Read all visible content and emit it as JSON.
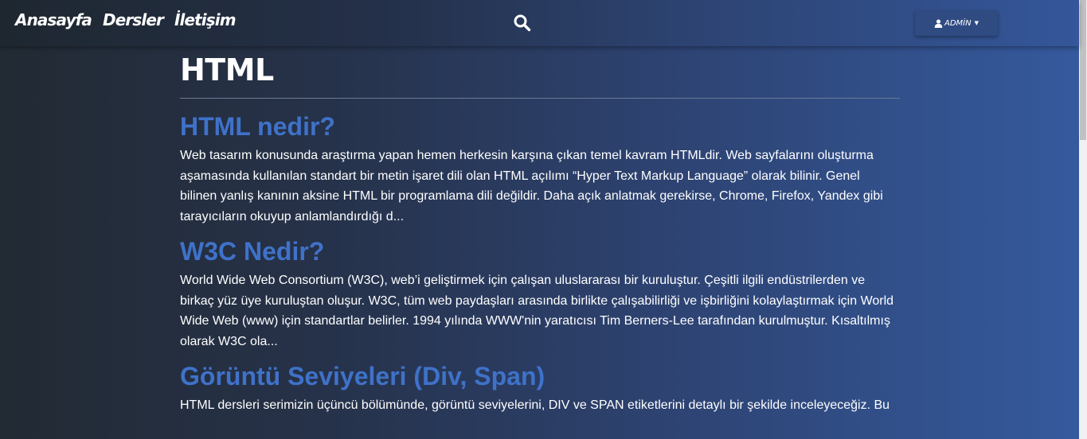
{
  "nav": {
    "links": [
      "Anasayfa",
      "Dersler",
      "İletişim"
    ],
    "search_icon": "search-icon",
    "user_menu_label": "ADMİN",
    "user_icon": "user-icon",
    "caret_icon": "caret-down-icon"
  },
  "page": {
    "title": "HTML"
  },
  "articles": [
    {
      "title": "HTML nedir?",
      "excerpt": "Web tasarım konusunda araştırma yapan hemen herkesin karşına çıkan temel kavram HTMLdir. Web sayfalarını oluşturma aşamasında kullanılan standart bir metin işaret dili olan HTML açılımı “Hyper Text Markup Language” olarak bilinir. Genel bilinen yanlış kanının aksine HTML bir programlama dili değildir. Daha açık anlatmak gerekirse, Chrome, Firefox, Yandex gibi tarayıcıların okuyup anlamlandırdığı d..."
    },
    {
      "title": "W3C Nedir?",
      "excerpt": "World Wide Web Consortium (W3C), web’i geliştirmek için çalışan uluslararası bir kuruluştur. Çeşitli ilgili endüstrilerden ve birkaç yüz üye kuruluştan oluşur. W3C, tüm web paydaşları arasında birlikte çalışabilirliği ve işbirliğini kolaylaştırmak için World Wide Web (www) için standartlar belirler. 1994 yılında WWW'nin yaratıcısı Tim Berners-Lee tarafından kurulmuştur. Kısaltılmış olarak W3C ola..."
    },
    {
      "title": "Görüntü Seviyeleri (Div, Span)",
      "excerpt": "HTML dersleri serimizin üçüncü bölümünde, görüntü seviyelerini, DIV ve SPAN etiketlerini detaylı bir şekilde inceleyeceğiz. Bu"
    }
  ],
  "colors": {
    "article_title": "#3f72c9",
    "background_left": "#222a33",
    "background_right": "#355a9e",
    "admin_button": "#2f4b82"
  }
}
